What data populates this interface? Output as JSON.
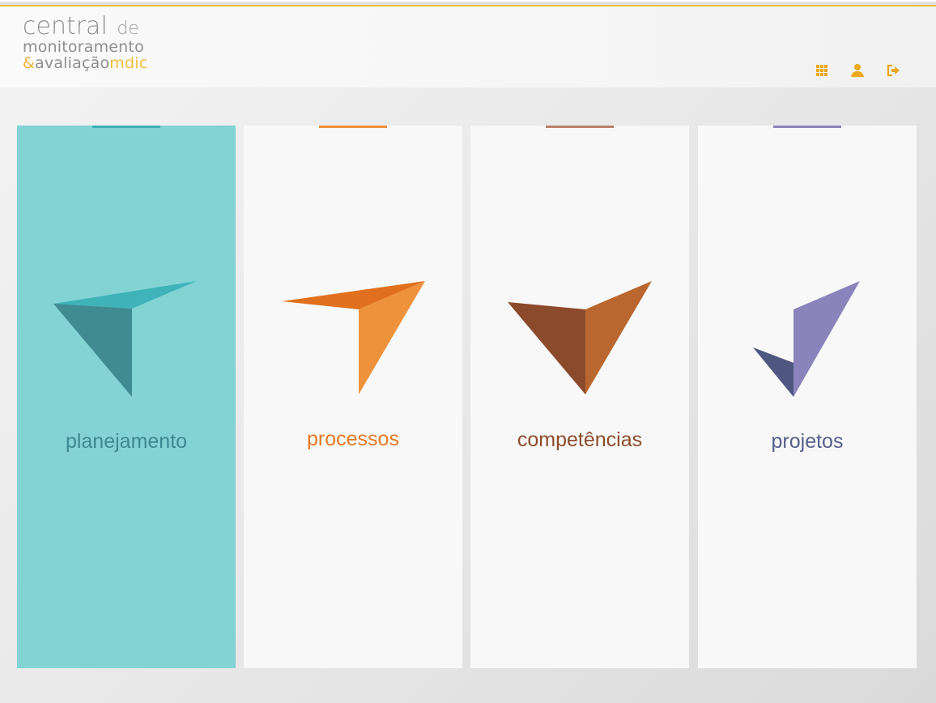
{
  "colors": {
    "header_accent": "#f0c040",
    "planejamento": "#3f8f93",
    "processos": "#e0701d",
    "competencias": "#8b4a2b",
    "projetos": "#5a6088"
  },
  "logo": {
    "line1_main": "central",
    "line1_suffix": "de",
    "line2": "monitoramento",
    "line3_amp": "&",
    "line3_main": "avaliação",
    "line3_brand": "mdic"
  },
  "header_icons": [
    "grid-icon",
    "user-icon",
    "logout-icon"
  ],
  "cards": [
    {
      "id": "planejamento",
      "label": "planejamento",
      "label_color": "#3e8790",
      "tab_color": "#3fb1b5",
      "active": true
    },
    {
      "id": "processos",
      "label": "processos",
      "label_color": "#e57a22",
      "tab_color": "#f0913e",
      "active": false
    },
    {
      "id": "competencias",
      "label": "competências",
      "label_color": "#8c4c2c",
      "tab_color": "#b9826a",
      "active": false
    },
    {
      "id": "projetos",
      "label": "projetos",
      "label_color": "#55608a",
      "tab_color": "#8b83bd",
      "active": false
    }
  ]
}
